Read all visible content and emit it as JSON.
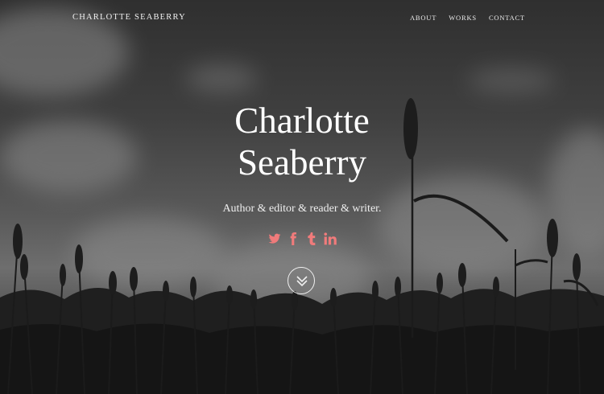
{
  "site": {
    "brand": "CHARLOTTE SEABERRY",
    "accent_color": "#f07b7b"
  },
  "nav": {
    "items": [
      {
        "label": "ABOUT"
      },
      {
        "label": "WORKS"
      },
      {
        "label": "CONTACT"
      }
    ]
  },
  "hero": {
    "title_line1": "Charlotte",
    "title_line2": "Seaberry",
    "tagline": "Author & editor & reader & writer."
  },
  "social": {
    "icons": [
      "twitter-icon",
      "facebook-icon",
      "tumblr-icon",
      "linkedin-icon"
    ]
  },
  "scroll_button": {
    "icon": "double-chevron-down-icon"
  }
}
